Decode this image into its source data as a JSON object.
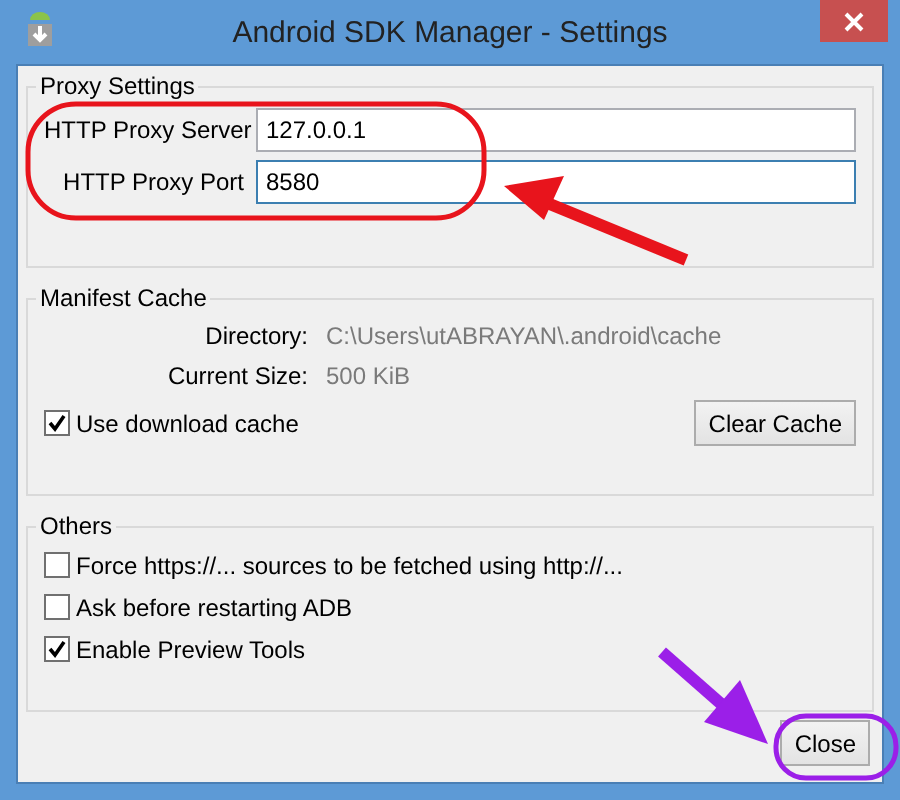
{
  "window": {
    "title": "Android SDK Manager - Settings"
  },
  "proxy": {
    "title": "Proxy Settings",
    "fields": [
      {
        "label": "HTTP Proxy Server",
        "value": "127.0.0.1",
        "focused": false
      },
      {
        "label": "HTTP Proxy Port",
        "value": "8580",
        "focused": true
      }
    ]
  },
  "manifest": {
    "title": "Manifest Cache",
    "info": [
      {
        "label": "Directory:",
        "value": "C:\\Users\\utABRAYAN\\.android\\cache"
      },
      {
        "label": "Current Size:",
        "value": "500 KiB"
      }
    ],
    "use_cache": {
      "label": "Use download cache",
      "checked": true
    },
    "button": "Clear Cache"
  },
  "others": {
    "title": "Others",
    "options": [
      {
        "label": "Force https://... sources to be fetched using http://...",
        "checked": false
      },
      {
        "label": "Ask before restarting ADB",
        "checked": false
      },
      {
        "label": "Enable Preview Tools",
        "checked": true
      }
    ]
  },
  "close_button": "Close"
}
